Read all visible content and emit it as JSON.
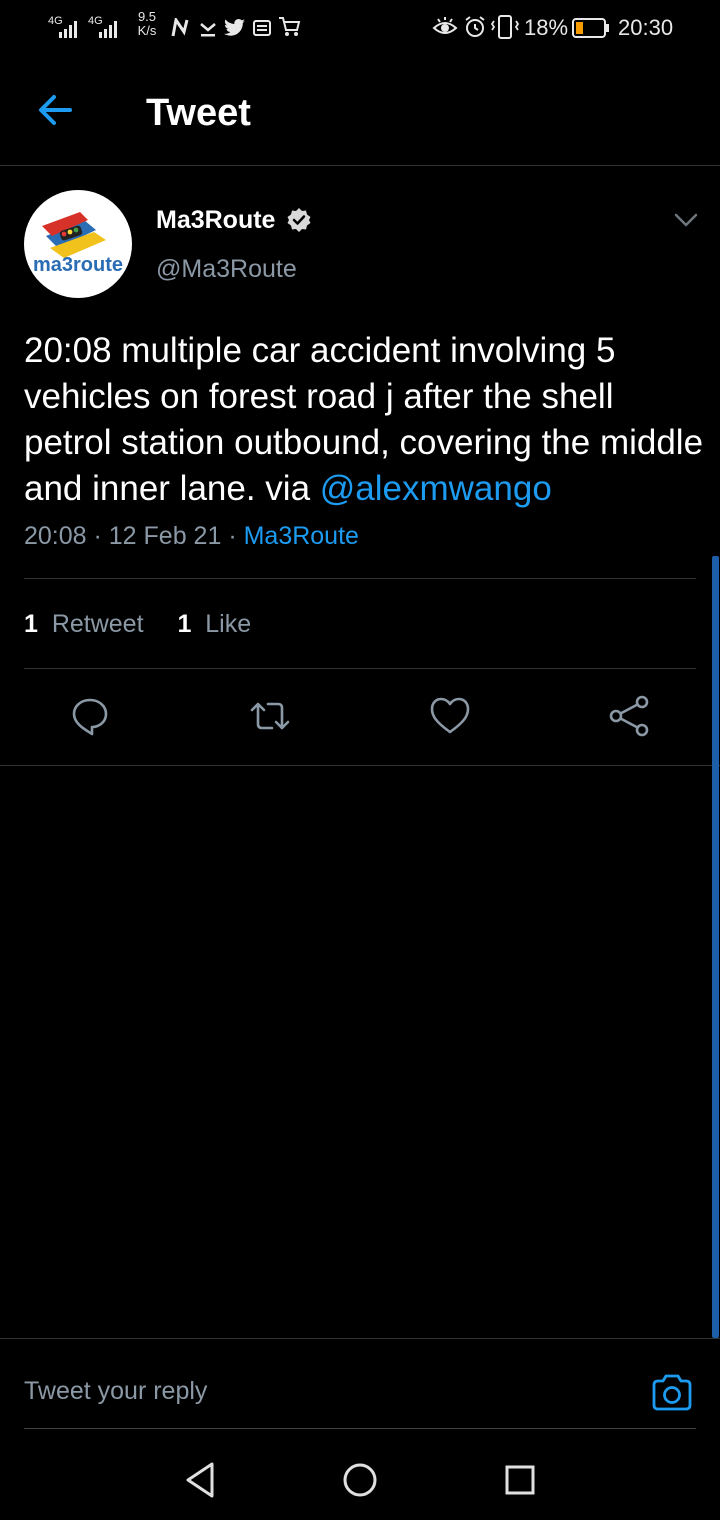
{
  "status_bar": {
    "signal1": "4G",
    "signal2": "4G",
    "speed_value": "9.5",
    "speed_unit": "K/s",
    "battery_percent": "18%",
    "time": "20:30"
  },
  "header": {
    "title": "Tweet"
  },
  "tweet": {
    "author_name": "Ma3Route",
    "author_handle": "@Ma3Route",
    "avatar_logo_text": "ma3route",
    "text": "20:08 multiple car accident involving 5 vehicles on forest road j after the shell petrol station  outbound, covering the middle and inner lane. via ",
    "mention": "@alexmwango",
    "time": "20:08",
    "date": "12 Feb 21",
    "source": "Ma3Route",
    "retweet_count": "1",
    "retweet_label": "Retweet",
    "like_count": "1",
    "like_label": "Like"
  },
  "reply": {
    "placeholder": "Tweet your reply"
  },
  "colors": {
    "background": "#000000",
    "accent": "#1d9bf0",
    "secondary_text": "#8b98a5",
    "divider": "#2f3336"
  },
  "icons": {
    "back": "arrow-left-icon",
    "verified": "verified-badge-icon",
    "more": "chevron-down-icon",
    "reply": "comment-icon",
    "retweet": "retweet-icon",
    "like": "heart-icon",
    "share": "share-icon",
    "camera": "camera-icon"
  }
}
